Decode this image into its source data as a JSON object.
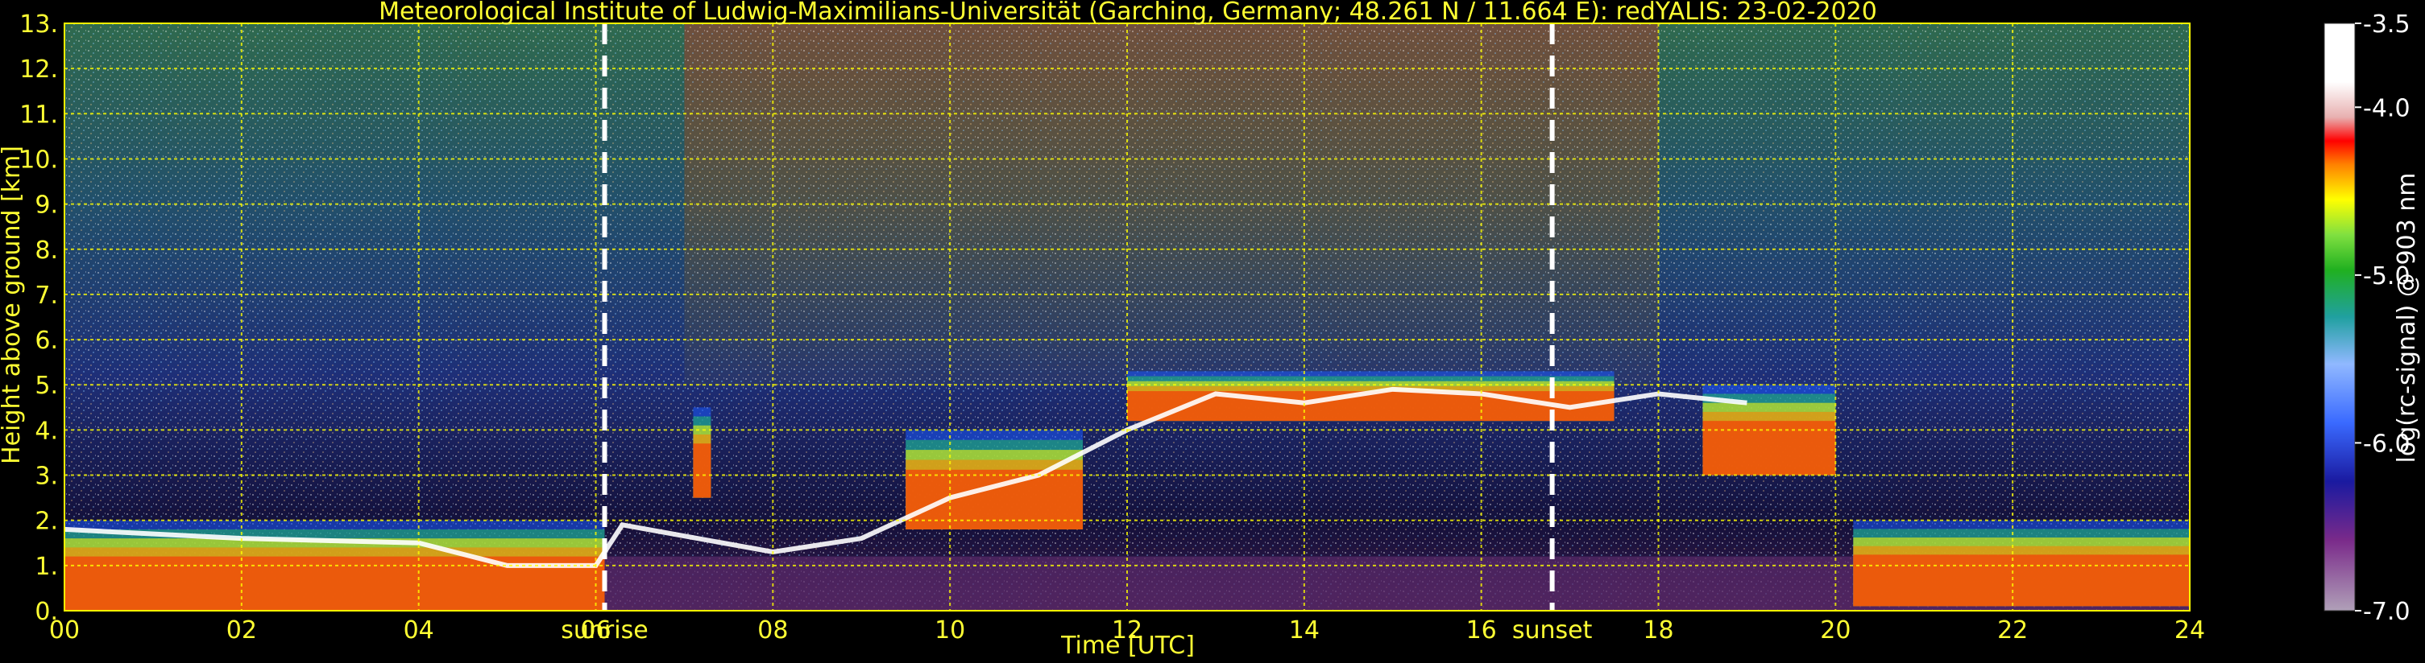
{
  "chart_data": {
    "type": "heatmap",
    "title": "Meteorological Institute of Ludwig-Maximilians-Universität (Garching, Germany; 48.261 N / 11.664 E):    redYALIS: 23-02-2020",
    "xlabel": "Time [UTC]",
    "ylabel": "Height above ground [km]",
    "xlim": [
      0,
      24
    ],
    "ylim": [
      0,
      13
    ],
    "x_ticks": [
      "00",
      "02",
      "04",
      "06",
      "08",
      "10",
      "12",
      "14",
      "16",
      "18",
      "20",
      "22",
      "24"
    ],
    "y_ticks": [
      "0.",
      "1.",
      "2.",
      "3.",
      "4.",
      "5.",
      "6.",
      "7.",
      "8.",
      "9.",
      "10.",
      "11.",
      "12.",
      "13."
    ],
    "grid": true,
    "annotations": [
      {
        "text": "sunrise",
        "x": 6.1
      },
      {
        "text": "sunset",
        "x": 16.8
      }
    ],
    "colorbar": {
      "label": "log(rc-signal) @ 903 nm",
      "range": [
        -7.0,
        -3.5
      ],
      "ticks": [
        "-3.5",
        "-4.0",
        "-5.0",
        "-6.0",
        "-7.0"
      ],
      "tick_values": [
        -3.5,
        -4.0,
        -5.0,
        -6.0,
        -7.0
      ]
    },
    "boundary_layer_top_km": [
      {
        "x": 0,
        "y": 1.8
      },
      {
        "x": 2,
        "y": 1.6
      },
      {
        "x": 4,
        "y": 1.5
      },
      {
        "x": 5,
        "y": 1.0
      },
      {
        "x": 6,
        "y": 1.0
      },
      {
        "x": 6.3,
        "y": 1.9
      },
      {
        "x": 8,
        "y": 1.3
      },
      {
        "x": 9,
        "y": 1.6
      },
      {
        "x": 10,
        "y": 2.5
      },
      {
        "x": 11,
        "y": 3.0
      },
      {
        "x": 12,
        "y": 4.0
      },
      {
        "x": 13,
        "y": 4.8
      },
      {
        "x": 14,
        "y": 4.6
      },
      {
        "x": 15,
        "y": 4.9
      },
      {
        "x": 16,
        "y": 4.8
      },
      {
        "x": 17,
        "y": 4.5
      },
      {
        "x": 18,
        "y": 4.8
      },
      {
        "x": 19,
        "y": 4.6
      }
    ],
    "cloud_layers": [
      {
        "x0": 0,
        "x1": 6.1,
        "y0": 0.0,
        "y1": 2.0
      },
      {
        "x0": 7.1,
        "x1": 7.3,
        "y0": 2.5,
        "y1": 4.5
      },
      {
        "x0": 9.5,
        "x1": 11.5,
        "y0": 1.8,
        "y1": 4.0
      },
      {
        "x0": 12.0,
        "x1": 17.5,
        "y0": 4.2,
        "y1": 5.3
      },
      {
        "x0": 18.5,
        "x1": 20.0,
        "y0": 3.0,
        "y1": 5.0
      },
      {
        "x0": 20.2,
        "x1": 24.0,
        "y0": 0.1,
        "y1": 2.0
      }
    ]
  }
}
